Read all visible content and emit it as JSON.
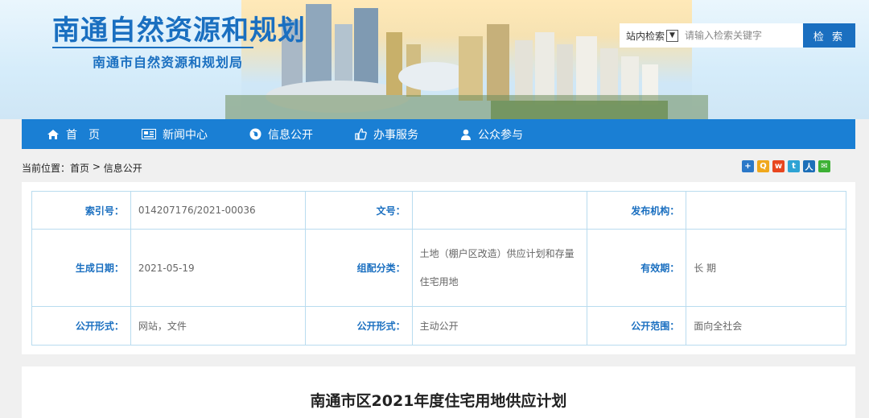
{
  "header": {
    "site_title": "南通自然资源和规划",
    "site_subtitle": "南通市自然资源和规划局"
  },
  "search": {
    "scope_label": "站内检索",
    "placeholder": "请输入检索关键字",
    "button_label": "检 索"
  },
  "nav": {
    "items": [
      {
        "label": "首　页",
        "icon": "home-icon"
      },
      {
        "label": "新闻中心",
        "icon": "newspaper-icon"
      },
      {
        "label": "信息公开",
        "icon": "globe-icon"
      },
      {
        "label": "办事服务",
        "icon": "thumbs-up-icon"
      },
      {
        "label": "公众参与",
        "icon": "user-icon"
      }
    ],
    "color": "#1a7fd4"
  },
  "breadcrumb": {
    "prefix": "当前位置：",
    "home": "首页",
    "separator": " > ",
    "current": "信息公开"
  },
  "share": {
    "icons": [
      {
        "name": "share-more-icon",
        "glyph": "+",
        "color": "#2b78c8"
      },
      {
        "name": "share-qzone-icon",
        "glyph": "Q",
        "color": "#f0a81c"
      },
      {
        "name": "share-weibo-icon",
        "glyph": "w",
        "color": "#e8461f"
      },
      {
        "name": "share-tencent-weibo-icon",
        "glyph": "t",
        "color": "#2ea3d4"
      },
      {
        "name": "share-renren-icon",
        "glyph": "人",
        "color": "#1d6fb8"
      },
      {
        "name": "share-wechat-icon",
        "glyph": "✉",
        "color": "#3db135"
      }
    ]
  },
  "info": {
    "index_no_label": "索引号：",
    "index_no": "014207176/2021-00036",
    "doc_no_label": "文号：",
    "doc_no": "",
    "publisher_label": "发布机构：",
    "publisher": "",
    "date_label": "生成日期：",
    "date": "2021-05-19",
    "category_label": "组配分类：",
    "category_line1": "土地（棚户区改造）供应计划和存量",
    "category_line2": "住宅用地",
    "validity_label": "有效期：",
    "validity": "长 期",
    "form_label": "公开形式：",
    "form": "网站，文件",
    "method_label": "公开形式：",
    "method": "主动公开",
    "scope_label": "公开范围：",
    "scope": "面向全社会"
  },
  "article": {
    "title": "南通市区2021年度住宅用地供应计划"
  }
}
